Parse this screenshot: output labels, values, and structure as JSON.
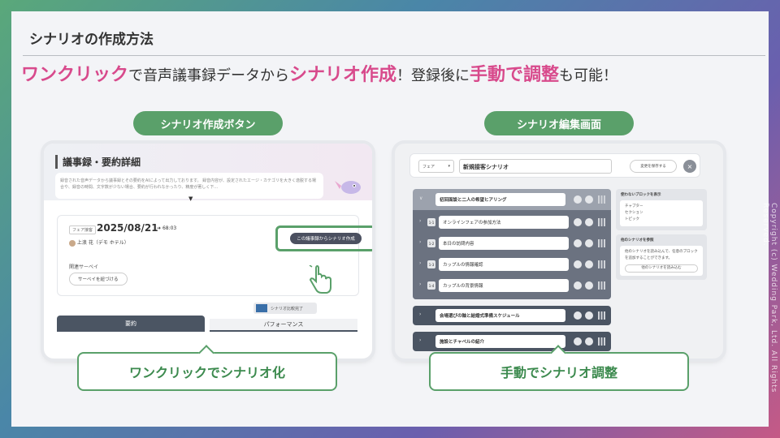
{
  "slide": {
    "title": "シナリオの作成方法",
    "headline": {
      "part1": "ワンクリック",
      "part2": "で音声議事録データから",
      "part3": "シナリオ作成",
      "part4": "！登録後に",
      "part5": "手動で調整",
      "part6": "も可能！"
    },
    "copyright": "Copyright (c) Wedding Park, Ltd. All Rights Reserved."
  },
  "left": {
    "pill": "シナリオ作成ボタン",
    "caption": "ワンクリックでシナリオ化",
    "screen": {
      "title": "議事録・要約詳細",
      "desc": "録音された音声データから議事録とその要約をAIによって出力しております。 録音内容が、設定されたエージ・カテゴリを大きく逸脱する場合や、録音の時間、文字数が少ない場合、要約が行われなかったり、精度が著しく下…",
      "tag": "フェア接客",
      "date": "2025/08/21",
      "duration": "68:03",
      "user": "上浪 花（デモ ホテル）",
      "create_button": "この議事録からシナリオ作成",
      "survey_label": "関連サーベイ",
      "survey_button": "サーベイを紐づける",
      "compare_label": "シナリオ比較完了",
      "tab_summary": "要約",
      "tab_performance": "パフォーマンス"
    }
  },
  "right": {
    "pill": "シナリオ編集画面",
    "caption": "手動でシナリオ調整",
    "screen": {
      "select": "フェア",
      "scenario_name": "新規接客シナリオ",
      "save_button": "変更を保存する",
      "block1": "初回面談と二人の希望ヒアリング",
      "rows": [
        {
          "num": "1-1",
          "text": "オンラインフェアの参加方法"
        },
        {
          "num": "1-2",
          "text": "本日の訪問内容"
        },
        {
          "num": "1-3",
          "text": "カップルの情報確認"
        },
        {
          "num": "1-4",
          "text": "カップルの背景情報"
        }
      ],
      "block2": "会場選びの軸と結婚式準備スケジュール",
      "block3": "施設とチャペルの紹介",
      "side1_title": "使わないブロックを表示",
      "side1_items": [
        "チャプター",
        "セクション",
        "トピック"
      ],
      "side2_title": "他のシナリオを参照",
      "side2_text": "他のシナリオを読み込んで、任意のブロックを追加することができます。",
      "side2_button": "他のシナリオを読み込む"
    }
  }
}
